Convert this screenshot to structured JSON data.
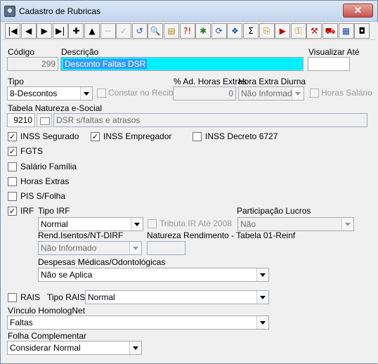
{
  "window": {
    "title": "Cadastro de Rubricas",
    "close_glyph": "✕"
  },
  "toolbar": {
    "buttons": [
      {
        "name": "first-record-button",
        "glyph": "|◀"
      },
      {
        "name": "prior-record-button",
        "glyph": "◀"
      },
      {
        "name": "next-record-button",
        "glyph": "▶"
      },
      {
        "name": "last-record-button",
        "glyph": "▶|"
      },
      {
        "name": "insert-button",
        "glyph": "✚"
      },
      {
        "name": "delete-button",
        "glyph": "▲"
      },
      {
        "name": "edit-button",
        "glyph": "−"
      },
      {
        "name": "post-button",
        "glyph": "✓"
      },
      {
        "name": "cancel-button",
        "glyph": "↺"
      },
      {
        "name": "search-button",
        "glyph": "🔍"
      },
      {
        "name": "export-button",
        "glyph": "▤"
      },
      {
        "name": "help-button",
        "glyph": "?!"
      },
      {
        "name": "filter-button",
        "glyph": "✱"
      },
      {
        "name": "refresh-button",
        "glyph": "⟳"
      },
      {
        "name": "formula-button",
        "glyph": "❖"
      },
      {
        "name": "sum-button",
        "glyph": "Σ"
      },
      {
        "name": "copy-button",
        "glyph": "⎘"
      },
      {
        "name": "report-button",
        "glyph": "▶"
      },
      {
        "name": "key-button",
        "glyph": "⚿"
      },
      {
        "name": "tools-button",
        "glyph": "⚒"
      },
      {
        "name": "vehicle-button",
        "glyph": "⛟"
      },
      {
        "name": "calendar-button",
        "glyph": "▦"
      },
      {
        "name": "exit-button",
        "glyph": "◘"
      }
    ]
  },
  "form": {
    "codigo_label": "Código",
    "codigo_value": "299",
    "descricao_label": "Descrição",
    "descricao_value": "Desconto Faltas DSR",
    "visualizar_label": "Visualizar Até",
    "visualizar_value": "",
    "tipo_label": "Tipo",
    "tipo_value": "8-Descontos",
    "constar_recibo_label": "Constar no Recibo",
    "ad_horas_label": "% Ad. Horas Extras",
    "ad_horas_value": "0",
    "hora_extra_label": "Hora Extra Diurna",
    "hora_extra_value": "Não Informado",
    "horas_salario_label": "Horas Salário",
    "natureza_label": "Tabela Natureza e-Social",
    "natureza_code": "9210",
    "natureza_desc": "DSR s/faltas e atrasos",
    "inss_segurado_label": "INSS Segurado",
    "inss_empregador_label": "INSS Empregador",
    "inss_decreto_label": "INSS Decreto 6727",
    "fgts_label": "FGTS",
    "salario_familia_label": "Salário Família",
    "horas_extras_label": "Horas Extras",
    "pis_label": "PIS S/Folha",
    "irf_label": "IRF",
    "tipo_irf_label": "Tipo IRF",
    "tipo_irf_value": "Normal",
    "tributa_ir_label": "Tributa IR Até 2008",
    "participacao_label": "Participação Lucros",
    "participacao_value": "Não",
    "rend_isentos_label": "Rend.Isentos/NT-DIRF",
    "rend_isentos_value": "Não Informado",
    "natureza_rend_label": "Natureza Rendimento - Tabela 01-Reinf",
    "natureza_rend_value": "",
    "despesas_label": "Despesas Médicas/Odontológicas",
    "despesas_value": "Não se Aplica",
    "rais_label": "RAIS",
    "tipo_rais_label": "Tipo RAIS",
    "tipo_rais_value": "Normal",
    "vinculo_label": "Vínculo HomologNet",
    "vinculo_value": "Faltas",
    "folha_label": "Folha Complementar",
    "folha_value": "Considerar Normal",
    "check_glyph": "✓"
  }
}
